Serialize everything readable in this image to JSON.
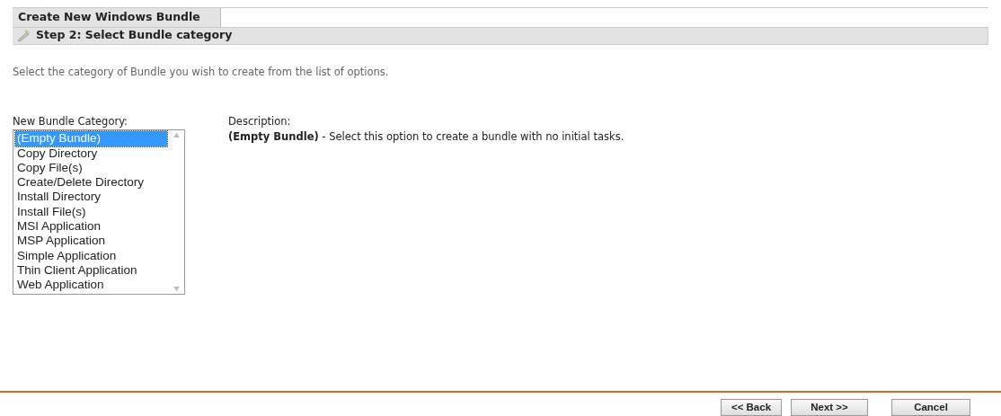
{
  "window": {
    "title": "Create New Windows Bundle"
  },
  "step": {
    "title": "Step 2: Select Bundle category"
  },
  "instructions": "Select the category of Bundle you wish to create from the list of options.",
  "category_list": {
    "label": "New Bundle Category:",
    "items": [
      {
        "label": "(Empty Bundle)",
        "selected": true
      },
      {
        "label": "Copy Directory",
        "selected": false
      },
      {
        "label": "Copy File(s)",
        "selected": false
      },
      {
        "label": "Create/Delete Directory",
        "selected": false
      },
      {
        "label": "Install Directory",
        "selected": false
      },
      {
        "label": "Install File(s)",
        "selected": false
      },
      {
        "label": "MSI Application",
        "selected": false
      },
      {
        "label": "MSP Application",
        "selected": false
      },
      {
        "label": "Simple Application",
        "selected": false
      },
      {
        "label": "Thin Client Application",
        "selected": false
      },
      {
        "label": "Web Application",
        "selected": false
      }
    ]
  },
  "description": {
    "label": "Description:",
    "text": "**(Empty Bundle)** - Select this option to create a bundle with no initial tasks."
  },
  "buttons": [
    {
      "label": "<< Back"
    },
    {
      "label": "Next >>"
    },
    {
      "label": "Cancel"
    }
  ]
}
